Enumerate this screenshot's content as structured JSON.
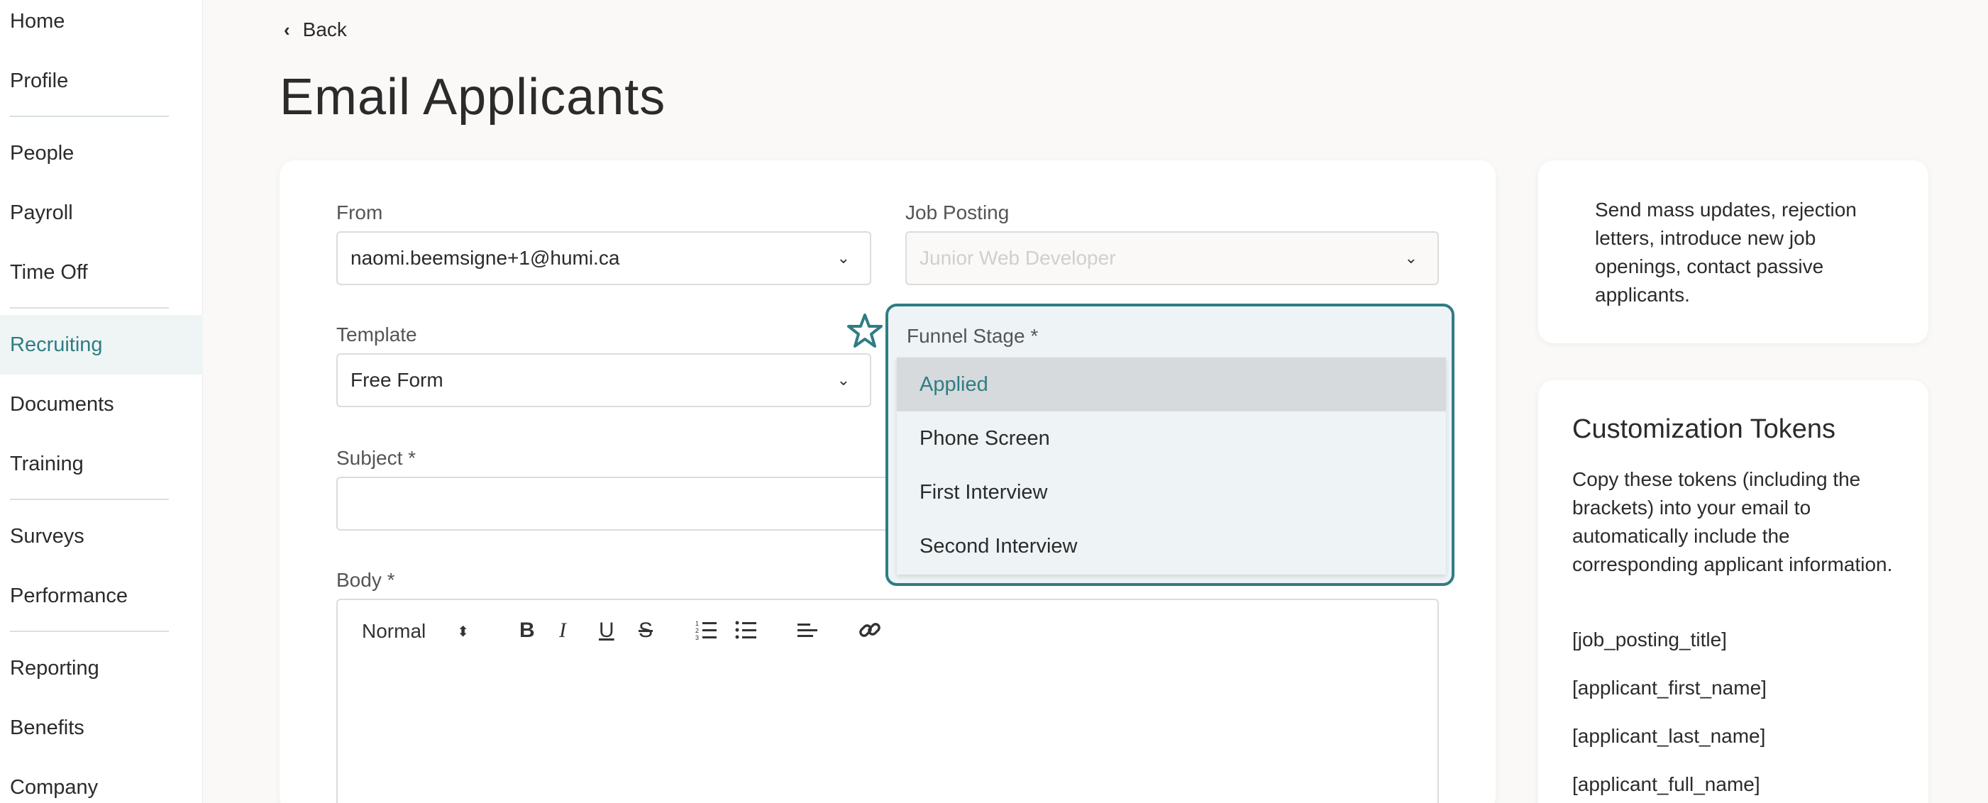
{
  "sidebar": {
    "items": [
      {
        "label": "Home"
      },
      {
        "label": "Profile"
      },
      {
        "label": "People"
      },
      {
        "label": "Payroll"
      },
      {
        "label": "Time Off"
      },
      {
        "label": "Recruiting",
        "active": true
      },
      {
        "label": "Documents"
      },
      {
        "label": "Training"
      },
      {
        "label": "Surveys"
      },
      {
        "label": "Performance"
      },
      {
        "label": "Reporting"
      },
      {
        "label": "Benefits"
      },
      {
        "label": "Company"
      }
    ]
  },
  "header": {
    "back_label": "Back",
    "title": "Email Applicants"
  },
  "form": {
    "from_label": "From",
    "from_value": "naomi.beemsigne+1@humi.ca",
    "job_posting_label": "Job Posting",
    "job_posting_value": "Junior Web Developer",
    "template_label": "Template",
    "template_value": "Free Form",
    "funnel_label": "Funnel Stage *",
    "funnel_options": [
      "Applied",
      "Phone Screen",
      "First Interview",
      "Second Interview"
    ],
    "funnel_selected": "Applied",
    "subject_label": "Subject *",
    "subject_value": "",
    "body_label": "Body *",
    "body_format": "Normal"
  },
  "info_card": {
    "text": "Send mass updates, rejection letters, introduce new job openings, contact passive applicants."
  },
  "tokens_card": {
    "title": "Customization Tokens",
    "description": "Copy these tokens (including the brackets) into your email to automatically include the corresponding applicant information.",
    "tokens": [
      "[job_posting_title]",
      "[applicant_first_name]",
      "[applicant_last_name]",
      "[applicant_full_name]"
    ]
  },
  "colors": {
    "accent": "#2f7d84",
    "background": "#faf9f7"
  }
}
